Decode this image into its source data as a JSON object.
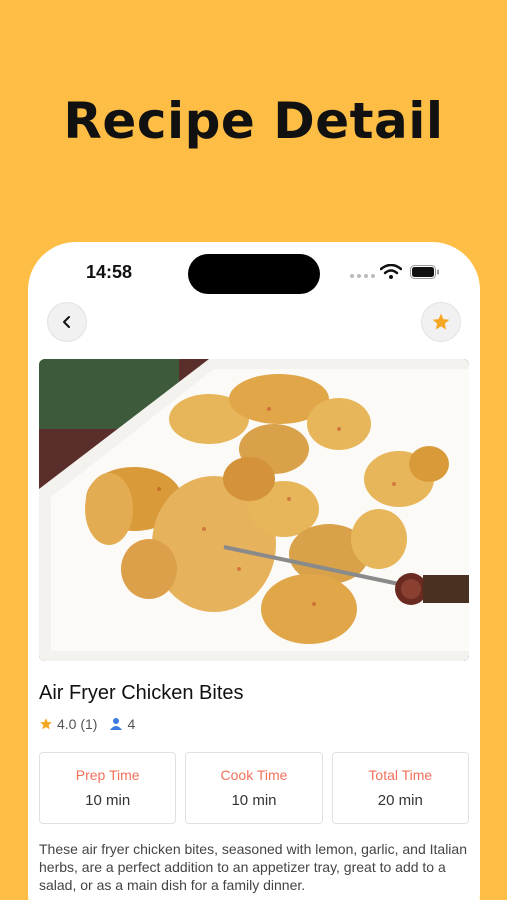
{
  "headline": "Recipe Detail",
  "status_bar": {
    "time": "14:58"
  },
  "recipe": {
    "title": "Air Fryer Chicken Bites",
    "rating": "4.0 (1)",
    "servings": "4",
    "stats": [
      {
        "label": "Prep Time",
        "value": "10 min"
      },
      {
        "label": "Cook Time",
        "value": "10 min"
      },
      {
        "label": "Total Time",
        "value": "20 min"
      }
    ],
    "description": "These air fryer chicken bites, seasoned with lemon, garlic, and Italian herbs, are a perfect addition to an appetizer tray, great to add to a salad, or as a main dish for a family dinner."
  },
  "icons": {
    "back": "chevron-left-icon",
    "favorite": "star-icon",
    "rating": "star-icon",
    "servings": "person-icon"
  },
  "colors": {
    "background": "#FEBE45",
    "accent": "#F5A623",
    "stat_label": "#F2715B",
    "servings_icon": "#3B7BE0"
  }
}
